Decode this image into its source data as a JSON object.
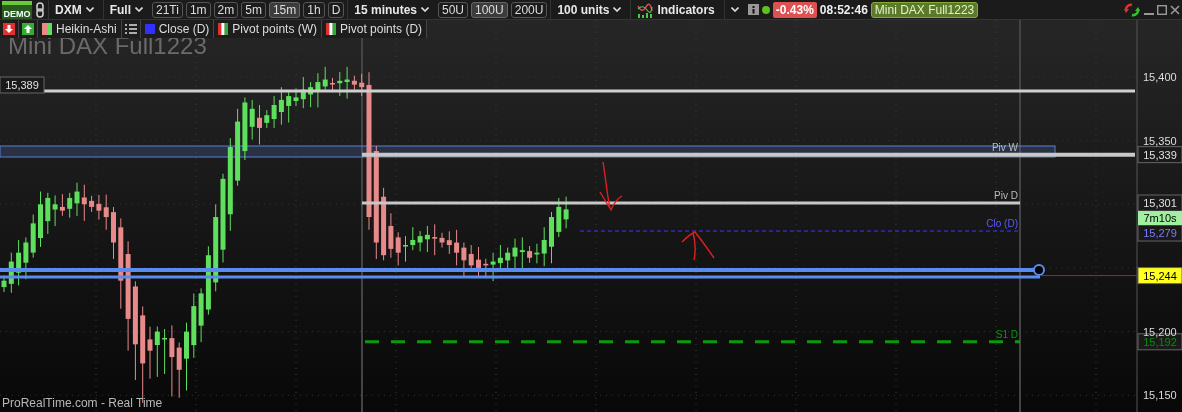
{
  "toolbar": {
    "demo_badge": "DEMO",
    "symbol": "DXM",
    "mode": "Full",
    "intervals": [
      {
        "label": "21Ti",
        "selected": false
      },
      {
        "label": "1m",
        "selected": false
      },
      {
        "label": "2m",
        "selected": false
      },
      {
        "label": "5m",
        "selected": false
      },
      {
        "label": "15m",
        "selected": true
      },
      {
        "label": "1h",
        "selected": false
      },
      {
        "label": "D",
        "selected": false
      }
    ],
    "interval_select": "15 minutes",
    "units": [
      {
        "label": "50U",
        "selected": false
      },
      {
        "label": "100U",
        "selected": true
      },
      {
        "label": "200U",
        "selected": false
      }
    ],
    "units_select": "100 units",
    "indicators": "Indicators",
    "status_online": true,
    "change": "-0.43%",
    "time": "08:52:46",
    "instrument": "Mini DAX Full1223"
  },
  "legend": [
    {
      "label": "Heikin-Ashi",
      "kind": "candles"
    },
    {
      "label": "Close (D)",
      "kind": "line",
      "color": "#3030ff"
    },
    {
      "label": "Pivot points (W)",
      "kind": "pivot"
    },
    {
      "label": "Pivot points (D)",
      "kind": "pivot"
    }
  ],
  "chart": {
    "watermark": "Mini DAX Full1223",
    "y_axis": [
      "15,400",
      "15,350",
      "15,200",
      "15,150"
    ],
    "levels": [
      {
        "kind": "band",
        "tag": "15,389"
      },
      {
        "kind": "weekly_pivot",
        "label": "Piv W",
        "tag": "15,339"
      },
      {
        "kind": "daily_pivot",
        "label": "Piv D",
        "tag": "15,301"
      },
      {
        "kind": "close",
        "label": "Clo (D)",
        "tag": "15,279"
      },
      {
        "kind": "last",
        "tag": "15,244"
      },
      {
        "kind": "support",
        "label": "S1 D",
        "tag": "15,192"
      }
    ],
    "countdown": "7m10s",
    "source": "ProRealTime.com - Real Time"
  }
}
